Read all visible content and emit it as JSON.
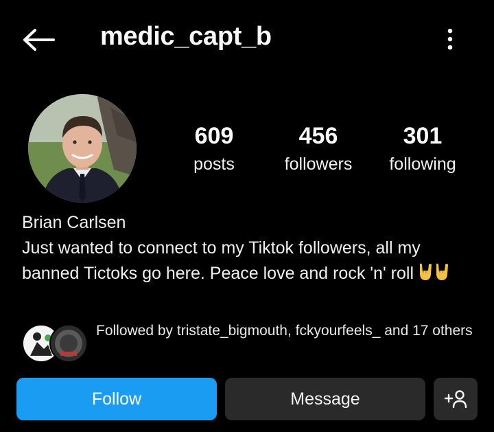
{
  "header": {
    "back_icon": "arrow-left-icon",
    "username": "medic_capt_b",
    "more_icon": "vertical-dots-icon"
  },
  "stats": {
    "posts": {
      "count": "609",
      "label": "posts"
    },
    "followers": {
      "count": "456",
      "label": "followers"
    },
    "following": {
      "count": "301",
      "label": "following"
    }
  },
  "bio": {
    "full_name": "Brian Carlsen",
    "text": "Just wanted to connect to my Tiktok followers, all my banned Tictoks go here. Peace love and rock 'n' roll",
    "emoji": "🤘🤘"
  },
  "followed_by": {
    "text": "Followed by tristate_bigmouth, fckyourfeels_ and 17 others"
  },
  "actions": {
    "follow_label": "Follow",
    "message_label": "Message",
    "add_user_icon": "add-person-icon"
  },
  "colors": {
    "background": "#000000",
    "follow_button": "#1a9cf2",
    "secondary_button": "#2a2a2a",
    "text": "#f5f5f5"
  }
}
